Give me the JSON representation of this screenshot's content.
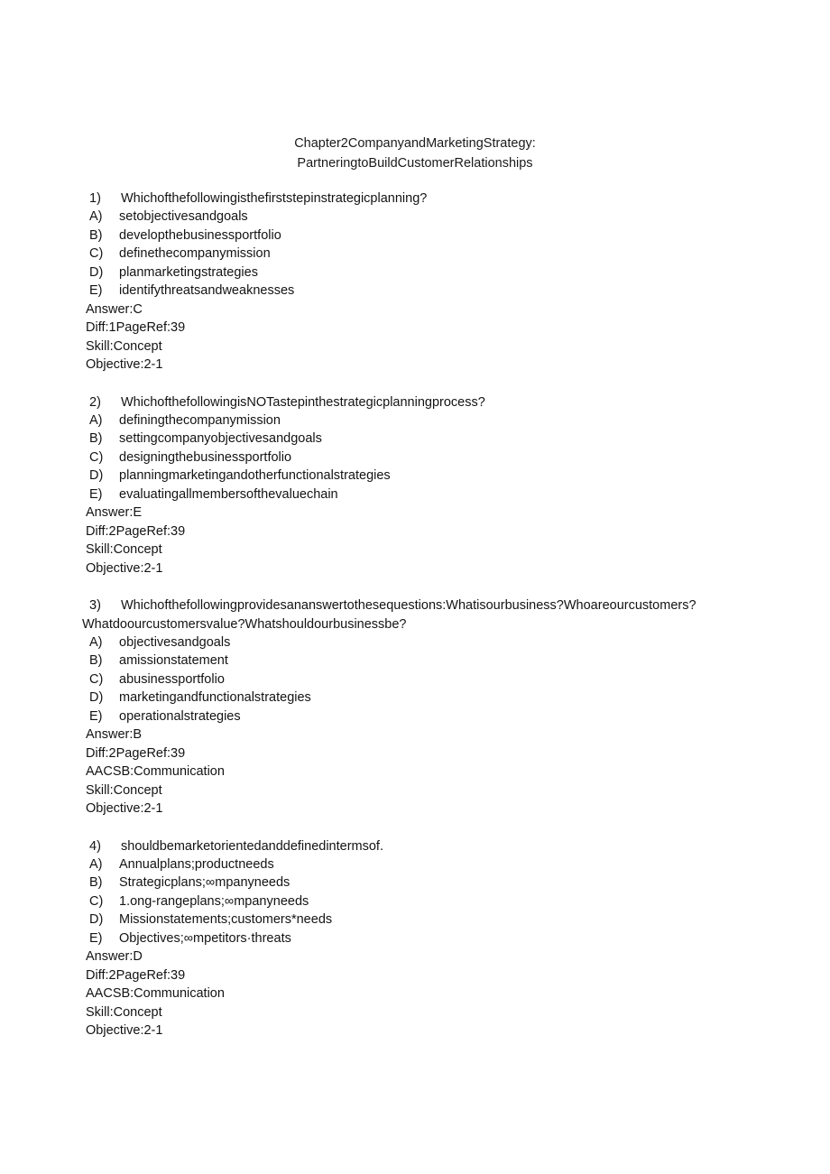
{
  "document": {
    "title_lines": [
      "Chapter2CompanyandMarketingStrategy:",
      "PartneringtoBuildCustomerRelationships"
    ]
  },
  "questions": [
    {
      "number": "1)",
      "stem": "Whichofthefollowingisthefirststepinstrategicplanning?",
      "stem_continuation": "",
      "options": [
        {
          "marker": "A)",
          "text": "setobjectivesandgoals"
        },
        {
          "marker": "B)",
          "text": "developthebusinessportfolio"
        },
        {
          "marker": "C)",
          "text": "definethecompanymission"
        },
        {
          "marker": "D)",
          "text": "planmarketingstrategies"
        },
        {
          "marker": "E)",
          "text": "identifythreatsandweaknesses"
        }
      ],
      "meta": [
        "Answer:C",
        "Diff:1PageRef:39",
        "Skill:Concept",
        "Objective:2-1"
      ]
    },
    {
      "number": "2)",
      "stem": "WhichofthefollowingisNOTastepinthestrategicplanningprocess?",
      "stem_continuation": "",
      "options": [
        {
          "marker": "A)",
          "text": "definingthecompanymission"
        },
        {
          "marker": "B)",
          "text": "settingcompanyobjectivesandgoals"
        },
        {
          "marker": "C)",
          "text": "designingthebusinessportfolio"
        },
        {
          "marker": "D)",
          "text": "planningmarketingandotherfunctionalstrategies"
        },
        {
          "marker": "E)",
          "text": "evaluatingallmembersofthevaluechain"
        }
      ],
      "meta": [
        "Answer:E",
        "Diff:2PageRef:39",
        "Skill:Concept",
        "Objective:2-1"
      ]
    },
    {
      "number": "3)",
      "stem": "Whichofthefollowingprovidesananswertothesequestions:Whatisourbusiness?Whoareourcustomers?",
      "stem_continuation": "Whatdoourcustomersvalue?Whatshouldourbusinessbe?",
      "options": [
        {
          "marker": "A)",
          "text": "objectivesandgoals"
        },
        {
          "marker": "B)",
          "text": "amissionstatement"
        },
        {
          "marker": "C)",
          "text": "abusinessportfolio"
        },
        {
          "marker": "D)",
          "text": "marketingandfunctionalstrategies"
        },
        {
          "marker": "E)",
          "text": "operationalstrategies"
        }
      ],
      "meta": [
        "Answer:B",
        "Diff:2PageRef:39",
        "AACSB:Communication",
        "Skill:Concept",
        "Objective:2-1"
      ]
    },
    {
      "number": "4)",
      "stem": "shouldbemarketorientedanddefinedintermsof.",
      "stem_continuation": "",
      "options": [
        {
          "marker": "A)",
          "text": "Annualplans;productneeds"
        },
        {
          "marker": "B)",
          "text": "Strategicplans;∞mpanyneeds"
        },
        {
          "marker": "C)",
          "text": "1.ong-rangeplans;∞mpanyneeds"
        },
        {
          "marker": "D)",
          "text": "Missionstatements;customers*needs"
        },
        {
          "marker": "E)",
          "text": "Objectives;∞mpetitors·threats"
        }
      ],
      "meta": [
        "Answer:D",
        "Diff:2PageRef:39",
        "AACSB:Communication",
        "Skill:Concept",
        "Objective:2-1"
      ]
    }
  ]
}
